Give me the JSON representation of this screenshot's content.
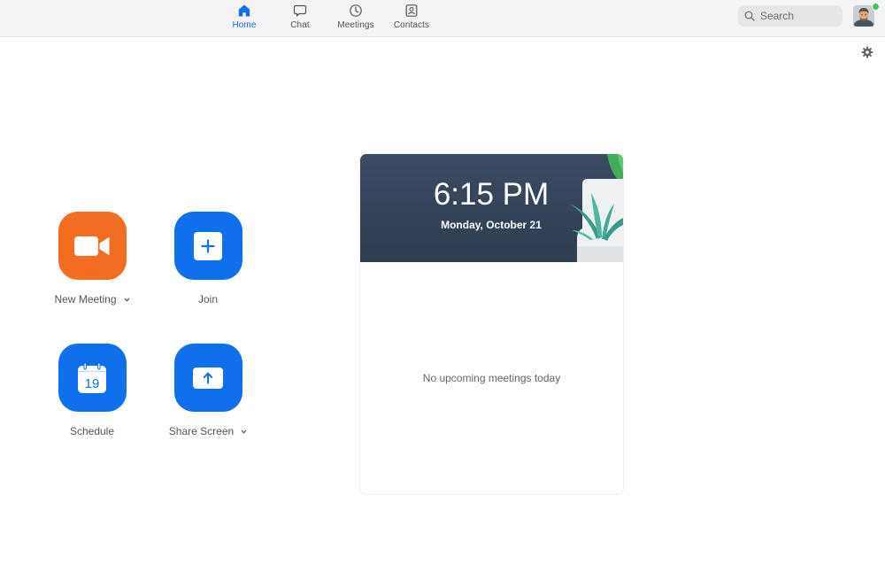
{
  "nav": {
    "tabs": [
      {
        "label": "Home",
        "icon": "home-icon",
        "active": true
      },
      {
        "label": "Chat",
        "icon": "chat-icon",
        "active": false
      },
      {
        "label": "Meetings",
        "icon": "clock-icon",
        "active": false
      },
      {
        "label": "Contacts",
        "icon": "contacts-icon",
        "active": false
      }
    ],
    "search_placeholder": "Search",
    "avatar_status": "online"
  },
  "actions": {
    "new_meeting": {
      "label": "New Meeting",
      "icon": "video-camera-icon",
      "color": "#F26D21",
      "has_dropdown": true
    },
    "join": {
      "label": "Join",
      "icon": "plus-icon",
      "color": "#0E71EB",
      "has_dropdown": false
    },
    "schedule": {
      "label": "Schedule",
      "icon": "calendar-icon",
      "calendar_day": "19",
      "color": "#0E71EB",
      "has_dropdown": false
    },
    "share_screen": {
      "label": "Share Screen",
      "icon": "upload-arrow-icon",
      "color": "#0E71EB",
      "has_dropdown": true
    }
  },
  "meeting_card": {
    "time": "6:15 PM",
    "date": "Monday, October 21",
    "empty_message": "No upcoming meetings today"
  },
  "colors": {
    "accent": "#0E71EB",
    "orange": "#F26D21",
    "banner": "#34435A",
    "presence": "#3CC761"
  }
}
